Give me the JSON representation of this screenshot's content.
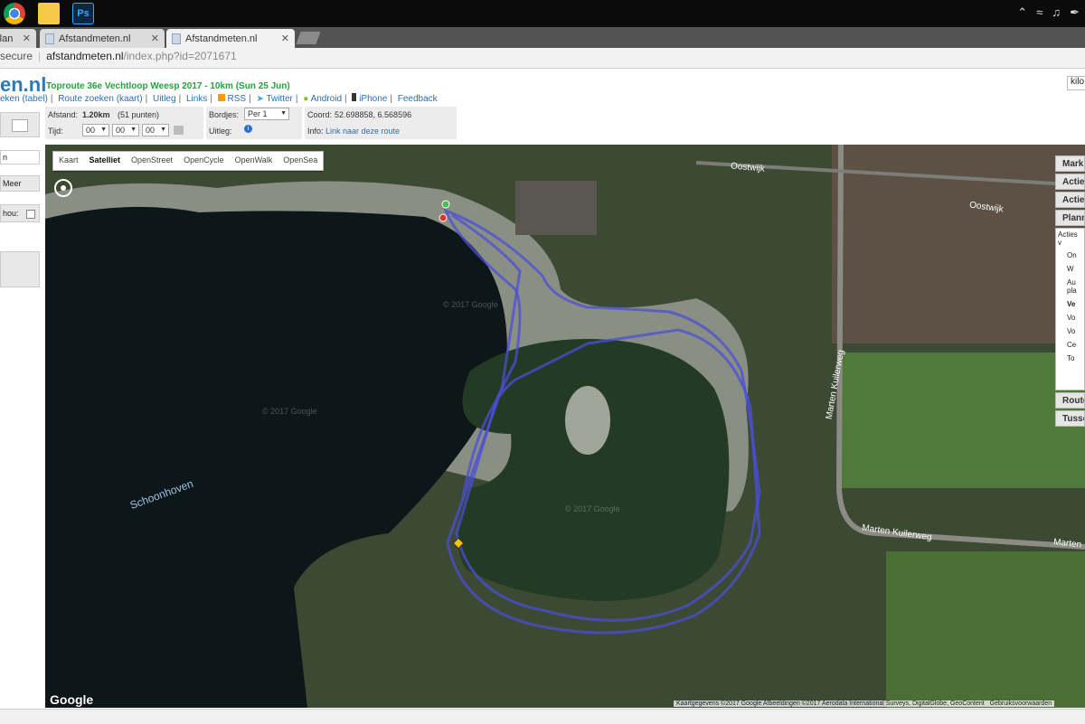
{
  "browser": {
    "tabs": [
      {
        "label": "rlan",
        "active": false
      },
      {
        "label": "Afstandmeten.nl",
        "active": false
      },
      {
        "label": "Afstandmeten.nl",
        "active": true
      }
    ],
    "security": "secure",
    "url_host": "afstandmeten.nl",
    "url_path": "/index.php?id=2071671"
  },
  "site": {
    "logo": "en.nl",
    "route_title": "Toproute 36e Vechtloop Weesp 2017 - 10km (Sun 25 Jun)",
    "nav": [
      "eken (tabel)",
      "Route zoeken (kaart)",
      "Uitleg",
      "Links",
      "RSS",
      "Twitter",
      "Android",
      "iPhone",
      "Feedback"
    ],
    "unit_select": "kilo"
  },
  "left_panel": {
    "items": [
      "n",
      "Meer",
      "hou:"
    ]
  },
  "info": {
    "afstand_label": "Afstand:",
    "afstand_value": "1.20km",
    "afstand_points": "(51 punten)",
    "tijd_label": "Tijd:",
    "tijd_hh": "00",
    "tijd_mm": "00",
    "tijd_ss": "00",
    "bordjes_label": "Bordjes:",
    "bordjes_value": "Per 1",
    "uitleg_label": "Uitleg:",
    "coord_label": "Coord:",
    "coord_value": "52.698858, 6.568596",
    "info_label": "Info:",
    "info_link": "Link naar deze route"
  },
  "map": {
    "types": [
      "Kaart",
      "Satelliet",
      "OpenStreet",
      "OpenCycle",
      "OpenWalk",
      "OpenSea"
    ],
    "active_type": "Satelliet",
    "labels": {
      "oostwijk_1": "Oostwijk",
      "oostwijk_2": "Oostwijk",
      "marten_vertical": "Marten Kuilerweg",
      "marten_1": "Marten Kuilerweg",
      "marten_2": "Marten",
      "schoonhoven": "Schoonhoven"
    },
    "watermark": "© 2017 Google",
    "copyright": "Kaartgegevens ©2017 Google Afbeeldingen ©2017 Aerodata International Surveys, DigitalGlobe, GeoContent",
    "terms": "Gebruiksvoorwaarden",
    "google_logo": "Google",
    "route_color": "#4b4fd6"
  },
  "right_panel": {
    "headers": [
      "Mark",
      "Actie",
      "Actie",
      "Plann"
    ],
    "body_title": "Acties v",
    "body_items": [
      "On",
      "W",
      "Au pla",
      "Ve",
      "Vo",
      "Vo",
      "Ce",
      "To"
    ],
    "footers": [
      "Route",
      "Tusse"
    ]
  }
}
